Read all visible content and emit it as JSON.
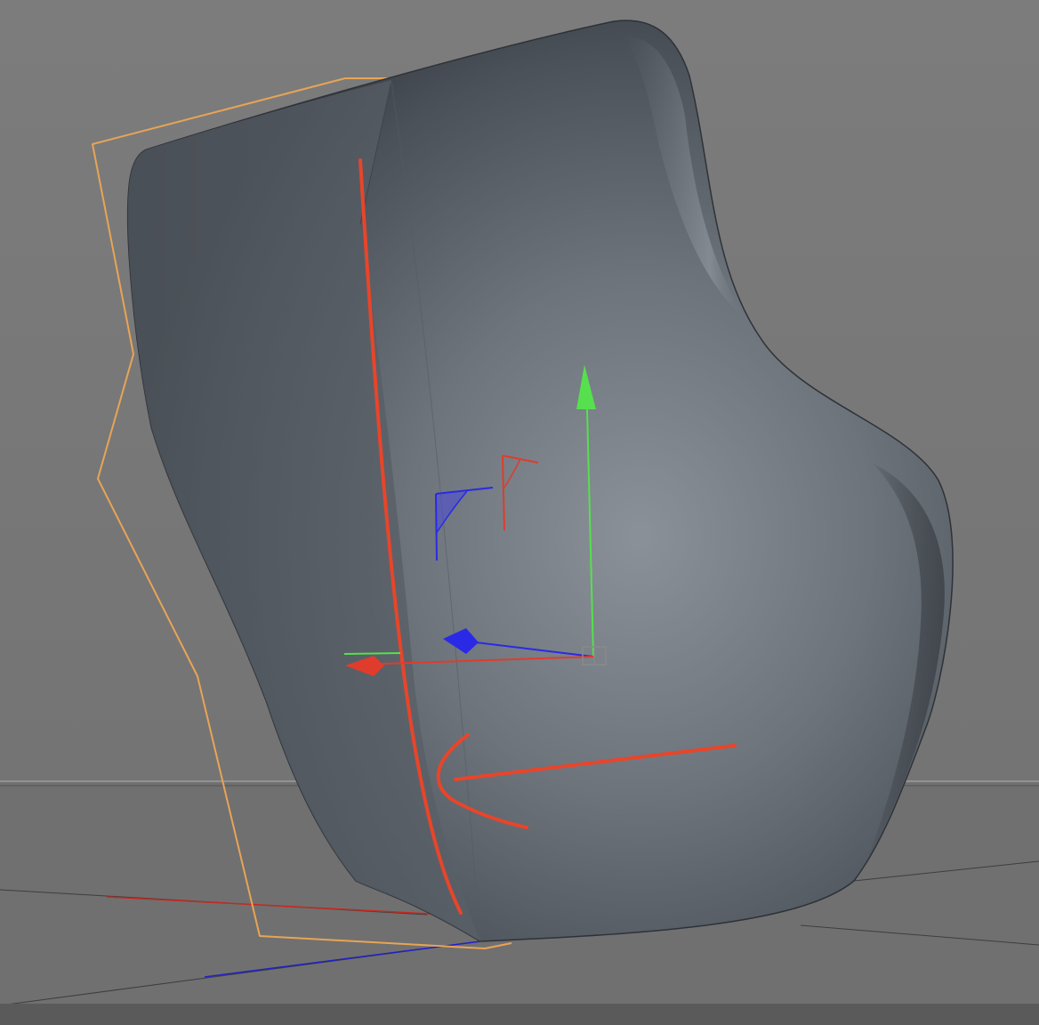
{
  "viewport": {
    "view": "perspective",
    "background_color": "#7a7a7a",
    "floor_color": "#707070",
    "horizon_line_color": "#8e8e8e"
  },
  "scene_object": {
    "kind": "cushion",
    "shading": "smooth-shaded",
    "color": "#747b84",
    "selected": true,
    "bounding_cage_color": "#e8a455"
  },
  "splines": {
    "color": "#e8452a",
    "count": 3
  },
  "gizmo": {
    "x_axis_color": "#e03c2c",
    "y_axis_color": "#56e04e",
    "z_axis_color": "#2a2ae6",
    "plane_handles": [
      "xy",
      "zy"
    ],
    "pivot_handle": "object-origin"
  },
  "world_axes": {
    "x_color": "#c8281e",
    "z_color": "#2020c8",
    "grid_color": "#3c3c3c"
  }
}
